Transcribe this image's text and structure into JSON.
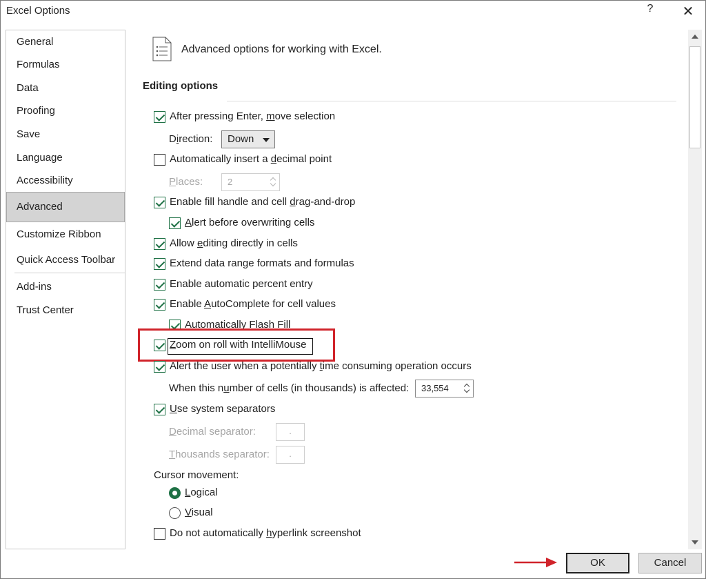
{
  "window": {
    "title": "Excel Options",
    "help_glyph": "?",
    "close_glyph": "✕"
  },
  "sidebar": {
    "items": [
      {
        "label": "General"
      },
      {
        "label": "Formulas"
      },
      {
        "label": "Data"
      },
      {
        "label": "Proofing"
      },
      {
        "label": "Save"
      },
      {
        "label": "Language"
      },
      {
        "label": "Accessibility"
      },
      {
        "label": "Advanced",
        "selected": true
      },
      {
        "label": "Customize Ribbon"
      },
      {
        "label": "Quick Access Toolbar"
      },
      {
        "label": "Add-ins"
      },
      {
        "label": "Trust Center"
      }
    ]
  },
  "header": {
    "text": "Advanced options for working with Excel.",
    "icon": "document-list-icon"
  },
  "editing": {
    "title": "Editing options",
    "after_enter": {
      "pre": "After pressing Enter, ",
      "u": "m",
      "post": "ove selection",
      "checked": true
    },
    "direction": {
      "pre": "D",
      "u": "i",
      "post": "rection:",
      "value": "Down"
    },
    "decimal": {
      "pre": "Automatically insert a ",
      "u": "d",
      "post": "ecimal point",
      "checked": false
    },
    "places": {
      "pre": "",
      "u": "P",
      "post": "laces:",
      "value": "2"
    },
    "fill_handle": {
      "pre": "Enable fill handle and cell ",
      "u": "d",
      "post": "rag-and-drop",
      "checked": true
    },
    "alert_overwrite": {
      "pre": "",
      "u": "A",
      "post": "lert before overwriting cells",
      "checked": true
    },
    "allow_editing": {
      "pre": "Allow ",
      "u": "e",
      "post": "diting directly in cells",
      "checked": true
    },
    "extend_formats": {
      "pre": "Extend data range formats and formulas",
      "u": "",
      "post": "",
      "checked": true
    },
    "percent_entry": {
      "pre": "Enable automatic percent entry",
      "u": "",
      "post": "",
      "checked": true
    },
    "autocomplete": {
      "pre": "Enable ",
      "u": "A",
      "post": "utoComplete for cell values",
      "checked": true
    },
    "flash_fill": {
      "pre": "Automatically Flash Fill",
      "u": "",
      "post": "",
      "checked": true
    },
    "zoom_roll": {
      "pre": "",
      "u": "Z",
      "post": "oom on roll with IntelliMouse",
      "checked": true
    },
    "alert_time": {
      "pre": "Alert the user when a potentially ",
      "u": "t",
      "post": "ime consuming operation occurs",
      "checked": true
    },
    "cells_affected": {
      "pre": "When this n",
      "u": "u",
      "post": "mber of cells (in thousands) is affected:",
      "value": "33,554"
    },
    "system_separators": {
      "pre": "",
      "u": "U",
      "post": "se system separators",
      "checked": true
    },
    "decimal_sep": {
      "pre": "",
      "u": "D",
      "post": "ecimal separator:",
      "value": "."
    },
    "thousands_sep": {
      "pre": "",
      "u": "T",
      "post": "housands separator:",
      "value": "."
    },
    "cursor_movement": "Cursor movement:",
    "logical": {
      "pre": "",
      "u": "L",
      "post": "ogical",
      "selected": true
    },
    "visual": {
      "pre": "",
      "u": "V",
      "post": "isual",
      "selected": false
    },
    "hyperlink": {
      "pre": "Do not automatically ",
      "u": "h",
      "post": "yperlink screenshot",
      "checked": false
    }
  },
  "buttons": {
    "ok": "OK",
    "cancel": "Cancel"
  },
  "colors": {
    "accent_green": "#1e7145",
    "highlight_red": "#d0232a"
  }
}
